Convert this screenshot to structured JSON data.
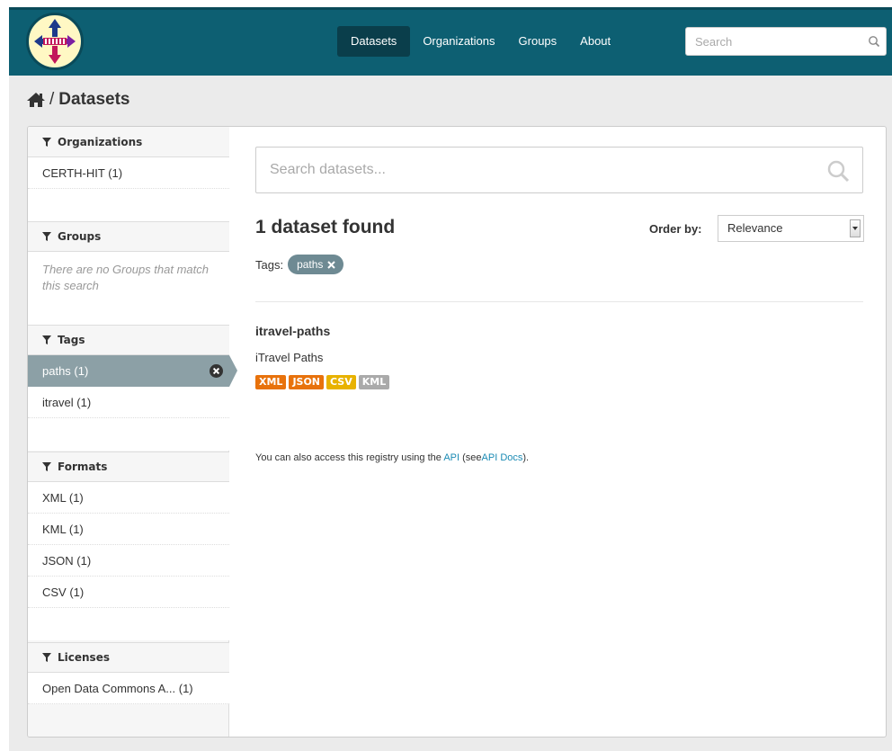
{
  "header": {
    "nav": [
      {
        "label": "Datasets",
        "active": true
      },
      {
        "label": "Organizations",
        "active": false
      },
      {
        "label": "Groups",
        "active": false
      },
      {
        "label": "About",
        "active": false
      }
    ],
    "search_placeholder": "Search"
  },
  "breadcrumb": {
    "separator": "/",
    "current": "Datasets"
  },
  "facets": {
    "organizations": {
      "title": "Organizations",
      "items": [
        "CERTH-HIT (1)"
      ]
    },
    "groups": {
      "title": "Groups",
      "empty_text": "There are no Groups that match this search"
    },
    "tags": {
      "title": "Tags",
      "items": [
        "paths (1)",
        "itravel (1)"
      ],
      "active_index": 0
    },
    "formats": {
      "title": "Formats",
      "items": [
        "XML (1)",
        "KML (1)",
        "JSON (1)",
        "CSV (1)"
      ]
    },
    "licenses": {
      "title": "Licenses",
      "items": [
        "Open Data Commons A... (1)"
      ]
    }
  },
  "search": {
    "placeholder": "Search datasets..."
  },
  "results": {
    "count_text": "1 dataset found",
    "order_label": "Order by:",
    "order_value": "Relevance",
    "tags_label": "Tags:",
    "active_tag": "paths"
  },
  "dataset": {
    "title": "itravel-paths",
    "notes": "iTravel Paths",
    "formats": [
      {
        "label": "XML",
        "color": "#e8720c"
      },
      {
        "label": "JSON",
        "color": "#e8720c"
      },
      {
        "label": "CSV",
        "color": "#e8b200"
      },
      {
        "label": "KML",
        "color": "#aaaaaa"
      }
    ]
  },
  "api_note": {
    "prefix": "You can also access this registry using the",
    "api_link": "API",
    "middle": "(see",
    "docs_link": "API Docs",
    "suffix": ")."
  },
  "colors": {
    "masthead": "#0d5f72",
    "nav_active": "#0a3e4b",
    "tag_pill": "#6e8a93",
    "link": "#1b8bb4"
  }
}
